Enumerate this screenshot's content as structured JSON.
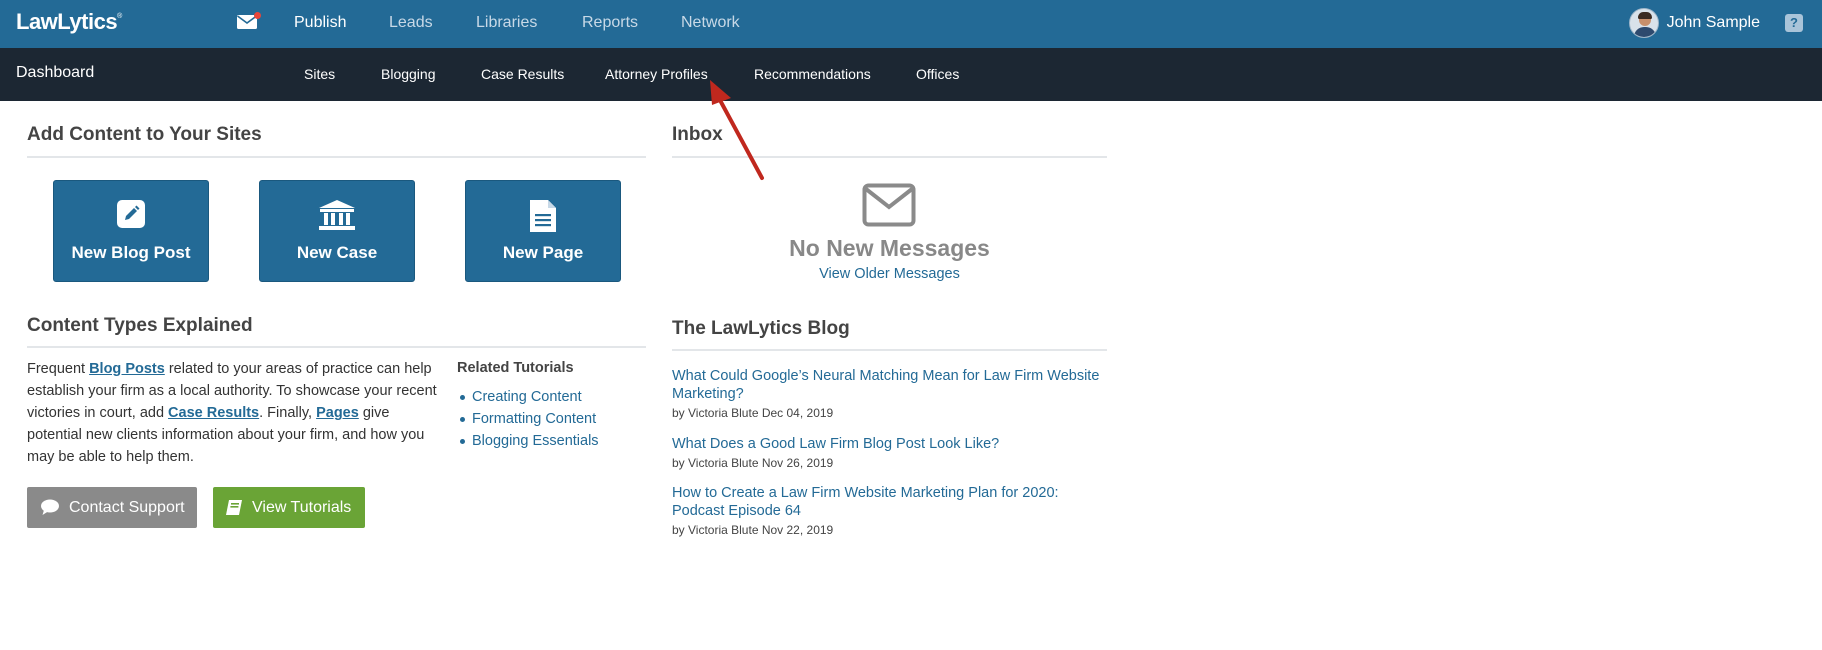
{
  "header": {
    "logo": "LawLytics",
    "logo_mark": "®",
    "nav": [
      {
        "label": "Publish",
        "active": true
      },
      {
        "label": "Leads",
        "active": false
      },
      {
        "label": "Libraries",
        "active": false
      },
      {
        "label": "Reports",
        "active": false
      },
      {
        "label": "Network",
        "active": false
      }
    ],
    "user_name": "John Sample",
    "help": "?",
    "mail_icon": "envelope-icon"
  },
  "subheader": {
    "title": "Dashboard",
    "nav": [
      "Sites",
      "Blogging",
      "Case Results",
      "Attorney Profiles",
      "Recommendations",
      "Offices"
    ]
  },
  "add_content": {
    "title": "Add Content to Your Sites",
    "tiles": [
      {
        "label": "New Blog Post",
        "icon": "edit-icon"
      },
      {
        "label": "New Case",
        "icon": "bank-icon"
      },
      {
        "label": "New Page",
        "icon": "document-icon"
      }
    ]
  },
  "explained": {
    "title": "Content Types Explained",
    "t1": "Frequent ",
    "link1": "Blog Posts",
    "t2": " related to your areas of practice can help establish your firm as a local authority. To showcase your recent victories in court, add ",
    "link2": "Case Results",
    "t3": ". Finally, ",
    "link3": "Pages",
    "t4": " give potential new clients information about your firm, and how you may be able to help them.",
    "related_title": "Related Tutorials",
    "related": [
      "Creating Content",
      "Formatting Content",
      "Blogging Essentials"
    ],
    "contact_btn": "Contact Support",
    "tutorials_btn": "View Tutorials"
  },
  "inbox": {
    "title": "Inbox",
    "empty": "No New Messages",
    "older": "View Older Messages"
  },
  "blog": {
    "title": "The LawLytics Blog",
    "posts": [
      {
        "title": "What Could Google’s Neural Matching Mean for Law Firm Website Marketing?",
        "meta": "by Victoria Blute Dec 04, 2019"
      },
      {
        "title": "What Does a Good Law Firm Blog Post Look Like?",
        "meta": "by Victoria Blute Nov 26, 2019"
      },
      {
        "title": "How to Create a Law Firm Website Marketing Plan for 2020: Podcast Episode 64",
        "meta": "by Victoria Blute Nov 22, 2019"
      }
    ]
  },
  "colors": {
    "primary": "#236a96",
    "subnav_bg": "#1c2733",
    "green": "#6aa436",
    "gray": "#8a8a8a",
    "annotation": "#c0281e"
  }
}
